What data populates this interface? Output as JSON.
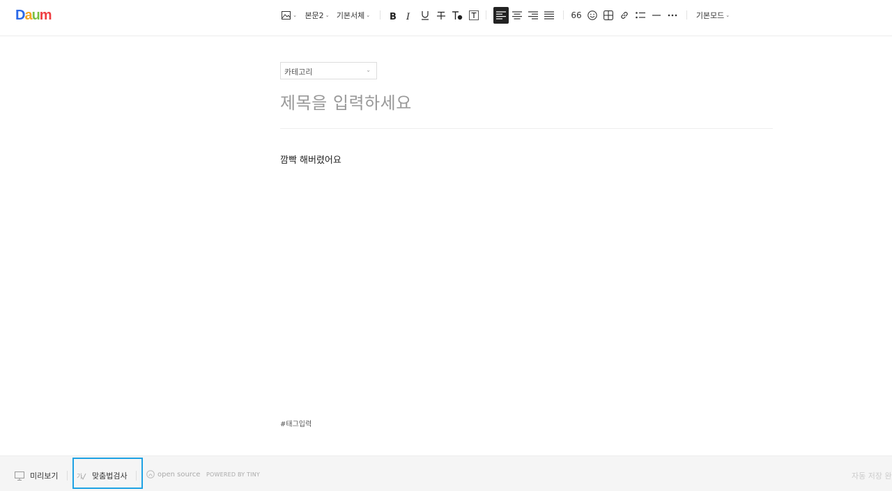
{
  "logo": {
    "parts": [
      "D",
      "a",
      "u",
      "m"
    ]
  },
  "toolbar": {
    "style_label": "본문2",
    "font_label": "기본서체",
    "mode_label": "기본모드",
    "quote_label": "66"
  },
  "editor": {
    "category_placeholder": "카테고리",
    "title_placeholder": "제목을 입력하세요",
    "body_text": "깜빡 해버렸어요",
    "tag_placeholder": "#태그입력"
  },
  "footer": {
    "preview_label": "미리보기",
    "spellcheck_label": "맞춤법검사",
    "opensource_label": "open source",
    "powered_label": "POWERED BY TINY",
    "autosave_label": "자동 저장 완료"
  },
  "colors": {
    "highlight": "#1ea2e4",
    "active_button": "#222222"
  }
}
